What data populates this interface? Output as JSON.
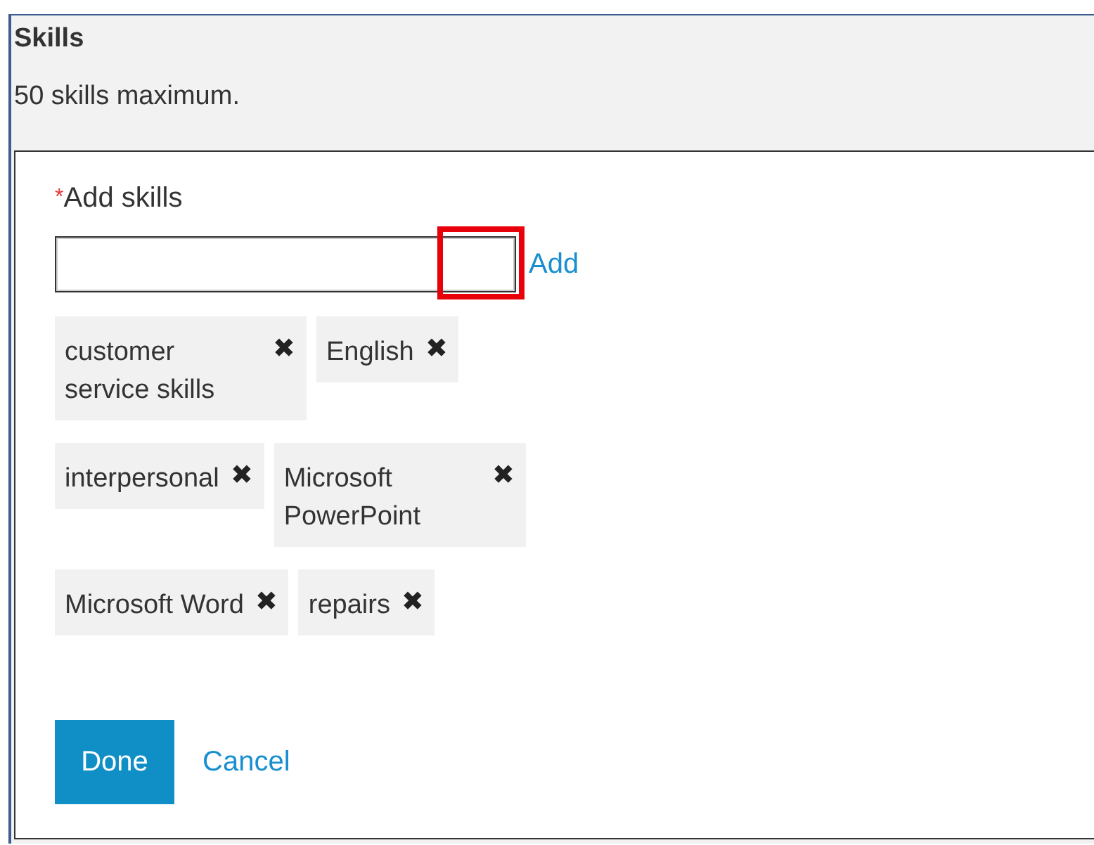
{
  "section": {
    "title": "Skills",
    "subtitle": "50 skills maximum."
  },
  "form": {
    "label": "Add skills",
    "required": true,
    "required_mark": "*",
    "input": {
      "highlighted": true
    },
    "add_link": "Add"
  },
  "tags": [
    {
      "label": "customer service skills",
      "remove": "✖"
    },
    {
      "label": "English",
      "remove": "✖"
    },
    {
      "label": "interpersonal",
      "remove": "✖"
    },
    {
      "label": "Microsoft PowerPoint",
      "remove": "✖"
    },
    {
      "label": "Microsoft Word",
      "remove": "✖"
    },
    {
      "label": "repairs",
      "remove": "✖"
    }
  ],
  "buttons": {
    "primary": "Done",
    "secondary": "Cancel"
  }
}
